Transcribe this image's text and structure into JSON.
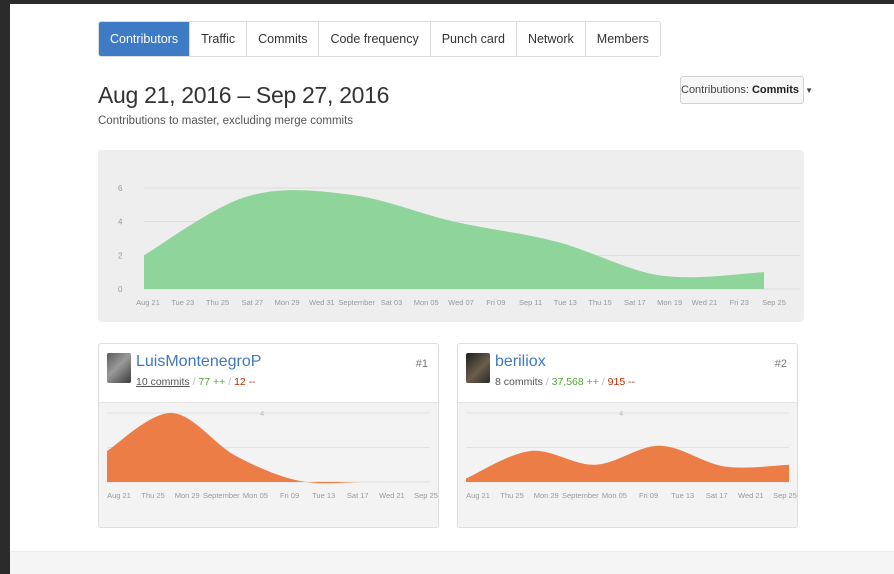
{
  "tabs": [
    {
      "label": "Contributors",
      "active": true
    },
    {
      "label": "Traffic",
      "active": false
    },
    {
      "label": "Commits",
      "active": false
    },
    {
      "label": "Code frequency",
      "active": false
    },
    {
      "label": "Punch card",
      "active": false
    },
    {
      "label": "Network",
      "active": false
    },
    {
      "label": "Members",
      "active": false
    }
  ],
  "header": {
    "title": "Aug 21, 2016 – Sep 27, 2016",
    "subtitle": "Contributions to master, excluding merge commits",
    "contributions_label": "Contributions:",
    "contributions_value": "Commits"
  },
  "colors": {
    "accent": "#3f7ac5",
    "main_area": "#8ed49b",
    "contributor_area": "#ed7d46",
    "additions": "#55a532",
    "deletions": "#bd2c00"
  },
  "chart_data": [
    {
      "type": "area",
      "series": [
        {
          "values": [
            2,
            5.5,
            5.6,
            4.0,
            2.8,
            0.8,
            1.0
          ]
        }
      ],
      "x": [
        "Aug 21",
        "Aug 28",
        "Sep 4",
        "Sep 11",
        "Sep 18",
        "Sep 25",
        "Sep 27"
      ],
      "ylim": [
        0,
        6
      ],
      "yticks": [
        "0",
        "2",
        "4",
        "6"
      ],
      "xticks": [
        "Aug 21",
        "Tue 23",
        "Thu 25",
        "Sat 27",
        "Mon 29",
        "Wed 31",
        "September",
        "Sat 03",
        "Mon 05",
        "Wed 07",
        "Fri 09",
        "Sep 11",
        "Tue 13",
        "Thu 15",
        "Sat 17",
        "Mon 19",
        "Wed 21",
        "Fri 23",
        "Sep 25"
      ]
    }
  ],
  "contributors": [
    {
      "name": "LuisMontenegroP",
      "commits": "10 commits",
      "additions": "77 ++",
      "deletions": "12 --",
      "rank": "#1",
      "chart": {
        "type": "area",
        "x": [
          "Aug 21",
          "Aug 28",
          "Sep 4",
          "Sep 11",
          "Sep 18",
          "Sep 25"
        ],
        "values": [
          1.8,
          4.0,
          1.5,
          0.05,
          0,
          0
        ],
        "ylim": [
          0,
          4
        ],
        "ytick": "4",
        "xticks": [
          "Aug 21",
          "Thu 25",
          "Mon 29",
          "September",
          "Mon 05",
          "Fri 09",
          "Tue 13",
          "Sat 17",
          "Wed 21",
          "Sep 25"
        ]
      }
    },
    {
      "name": "beriliox",
      "commits": "8 commits",
      "additions": "37,568 ++",
      "deletions": "915 --",
      "rank": "#2",
      "chart": {
        "type": "area",
        "x": [
          "Aug 21",
          "Aug 28",
          "Sep 4",
          "Sep 11",
          "Sep 18",
          "Sep 25"
        ],
        "values": [
          0.2,
          1.8,
          1.0,
          2.1,
          0.9,
          1.0
        ],
        "ylim": [
          0,
          4
        ],
        "ytick": "4",
        "xticks": [
          "Aug 21",
          "Thu 25",
          "Mon 29",
          "September",
          "Mon 05",
          "Fri 09",
          "Tue 13",
          "Sat 17",
          "Wed 21",
          "Sep 25"
        ]
      }
    }
  ]
}
